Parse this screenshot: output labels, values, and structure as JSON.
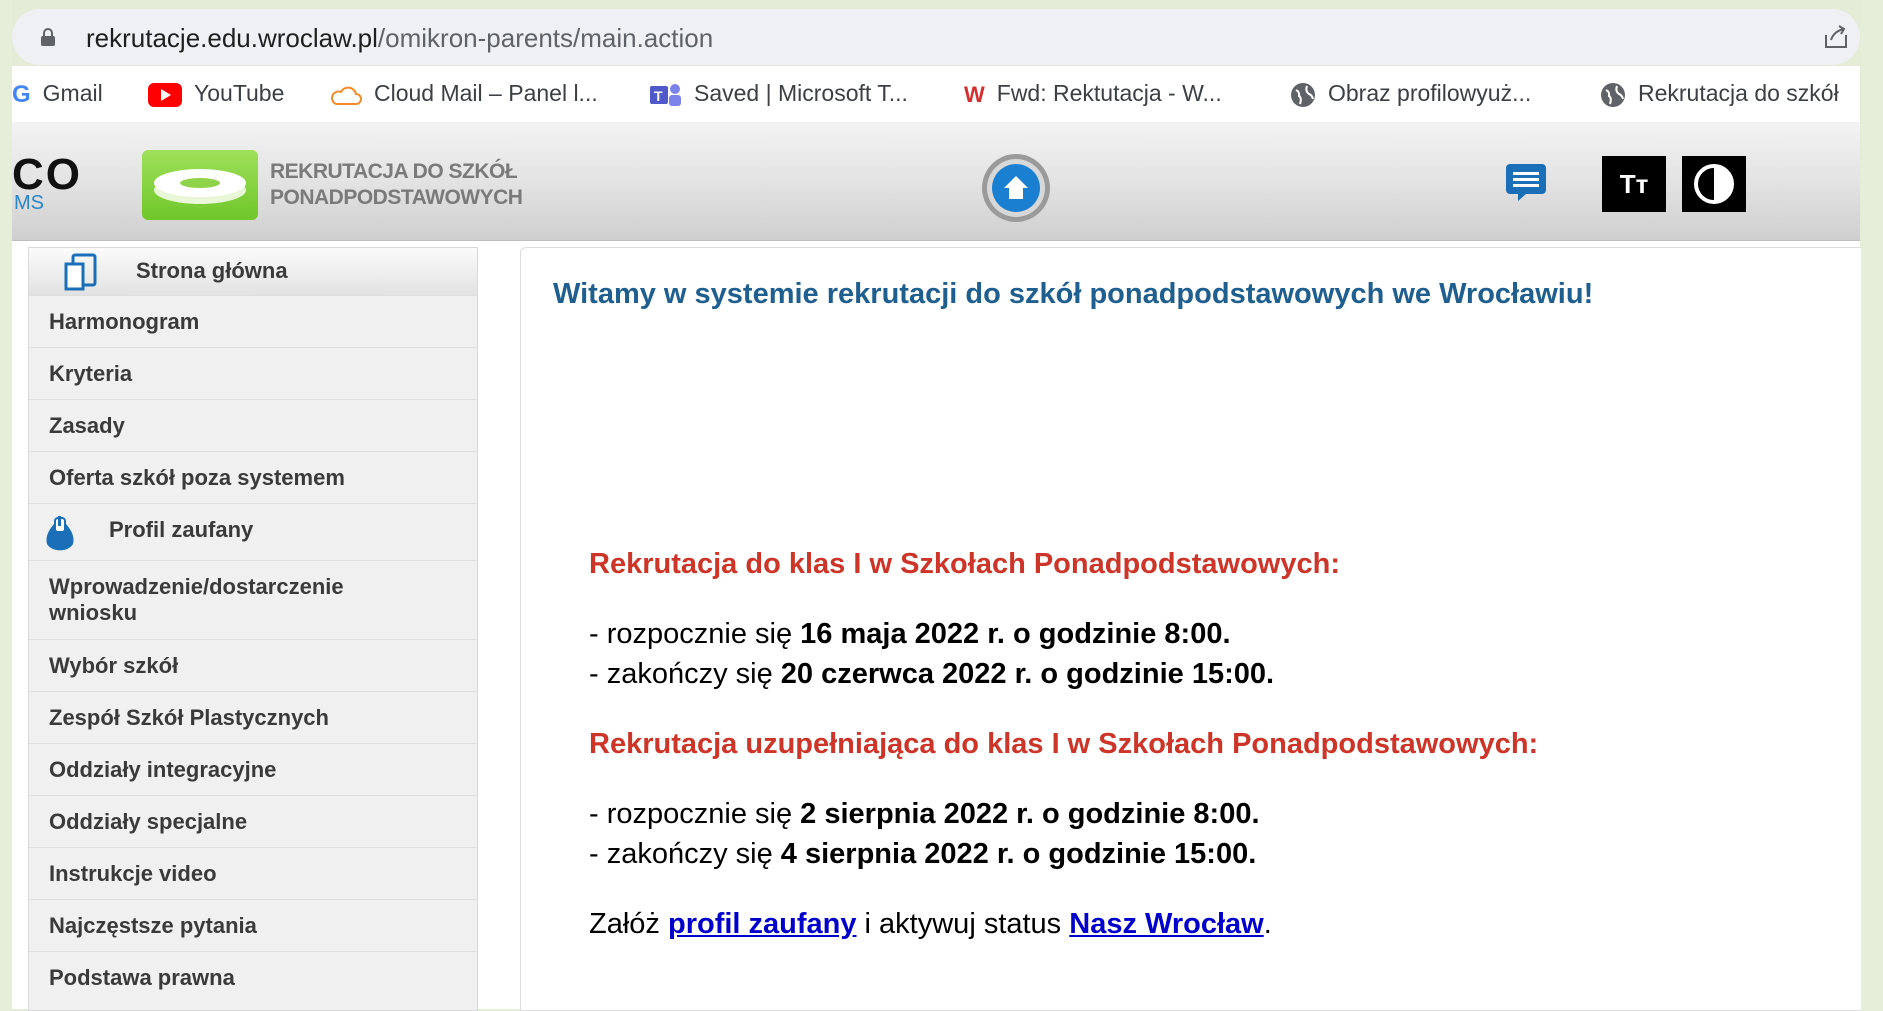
{
  "browser": {
    "url_host": "rekrutacje.edu.wroclaw.pl",
    "url_path": "/omikron-parents/main.action",
    "bookmarks": [
      {
        "label": "Gmail",
        "icon": "gmail-icon"
      },
      {
        "label": "YouTube",
        "icon": "youtube-icon"
      },
      {
        "label": "Cloud Mail – Panel l...",
        "icon": "cloud-mail-icon"
      },
      {
        "label": "Saved | Microsoft T...",
        "icon": "teams-icon"
      },
      {
        "label": "Fwd: Rektutacja - W...",
        "icon": "webmail-icon"
      },
      {
        "label": "Obraz profilowyuż...",
        "icon": "globe-icon"
      },
      {
        "label": "Rekrutacja do szkół",
        "icon": "globe-icon"
      }
    ]
  },
  "header": {
    "brand": "CO",
    "brand_sub": "MS",
    "logo_line1": "REKRUTACJA DO SZKÓŁ",
    "logo_line2": "PONADPODSTAWOWYCH",
    "font_button": "Tт"
  },
  "sidebar": {
    "items": [
      {
        "label": "Strona główna"
      },
      {
        "label": "Harmonogram"
      },
      {
        "label": "Kryteria"
      },
      {
        "label": "Zasady"
      },
      {
        "label": "Oferta szkół poza systemem"
      },
      {
        "label": "Profil zaufany"
      },
      {
        "label": "Wprowadzenie/dostarczenie",
        "label2": "wniosku"
      },
      {
        "label": "Wybór szkół"
      },
      {
        "label": "Zespół Szkół Plastycznych"
      },
      {
        "label": "Oddziały integracyjne"
      },
      {
        "label": "Oddziały specjalne"
      },
      {
        "label": "Instrukcje video"
      },
      {
        "label": "Najczęstsze pytania"
      },
      {
        "label": "Podstawa prawna"
      }
    ]
  },
  "main": {
    "welcome": "Witamy w systemie rekrutacji do szkół ponadpodstawowych we Wrocławiu!",
    "section1": {
      "heading": "Rekrutacja do klas I w Szkołach Ponadpodstawowych:",
      "line1_prefix": "- rozpocznie się ",
      "line1_bold": "16 maja 2022 r. o godzinie 8:00.",
      "line2_prefix": "- zakończy się ",
      "line2_bold": "20 czerwca 2022 r. o godzinie 15:00."
    },
    "section2": {
      "heading": "Rekrutacja uzupełniająca do klas I w Szkołach Ponadpodstawowych:",
      "line1_prefix": "- rozpocznie się ",
      "line1_bold": "2 sierpnia 2022 r. o godzinie 8:00.",
      "line2_prefix": "- zakończy się ",
      "line2_bold": "4 sierpnia 2022 r. o godzinie 15:00."
    },
    "footer": {
      "prefix": "Załóż ",
      "link1": "profil zaufany",
      "middle": " i aktywuj status ",
      "link2": "Nasz Wrocław",
      "suffix": "."
    }
  },
  "colors": {
    "welcome": "#1f5f8f",
    "heading_red": "#cc3527",
    "link": "#0000cc"
  }
}
